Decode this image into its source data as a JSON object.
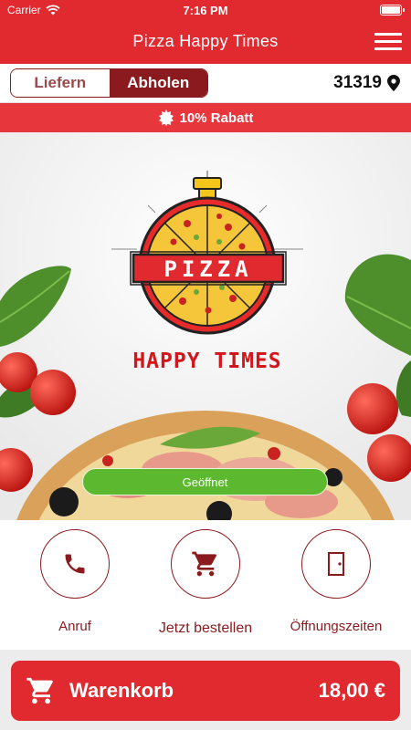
{
  "status": {
    "carrier": "Carrier",
    "time": "7:16 PM"
  },
  "header": {
    "title": "Pizza Happy Times"
  },
  "mode": {
    "deliver": "Liefern",
    "pickup": "Abholen",
    "zip": "31319"
  },
  "banner": {
    "discount": "10% Rabatt"
  },
  "hero": {
    "logo_word": "PIZZA",
    "logo_tagline": "HAPPY TIMES",
    "open_status": "Geöffnet"
  },
  "actions": {
    "call": "Anruf",
    "order": "Jetzt bestellen",
    "hours": "Öffnungszeiten"
  },
  "cart": {
    "label": "Warenkorb",
    "total": "18,00 €"
  },
  "colors": {
    "brand_red": "#e02a2f",
    "dark_red": "#8b1a1e",
    "open_green": "#5cb82e"
  }
}
